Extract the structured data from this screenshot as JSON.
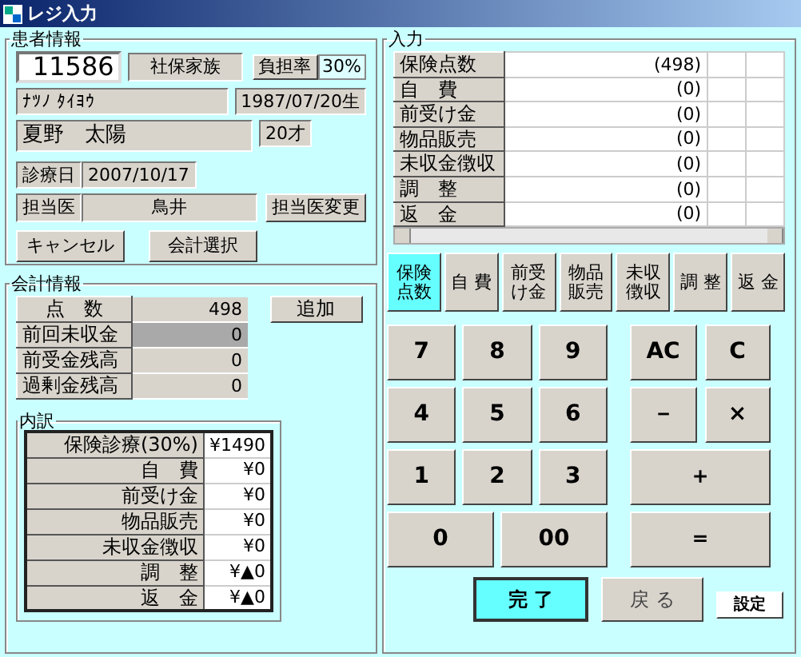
{
  "window": {
    "title": "レジ入力"
  },
  "patient": {
    "section_title": "患者情報",
    "id": "11586",
    "insurance_type": "社保家族",
    "burden_label": "負担率",
    "burden_rate": "30%",
    "kana_name": "ﾅﾂﾉ ﾀｲﾖｳ",
    "birth_date": "1987/07/20生",
    "name": "夏野　太陽",
    "age": "20才",
    "visit_label": "診療日",
    "visit_date": "2007/10/17",
    "doctor_label": "担当医",
    "doctor": "鳥井",
    "change_doctor_button": "担当医変更",
    "buttons": [
      "キャンセル",
      "会計選択"
    ]
  },
  "accounting": {
    "section_title": "会計情報",
    "add_button": "追加",
    "rows": [
      {
        "label": "点　数",
        "value": "498",
        "disabled": false
      },
      {
        "label": "前回未収金",
        "value": "0",
        "disabled": true
      },
      {
        "label": "前受金残高",
        "value": "0",
        "disabled": false
      },
      {
        "label": "過剰金残高",
        "value": "0",
        "disabled": false
      }
    ],
    "breakdown": {
      "title": "内訳",
      "rows": [
        {
          "label": "保険診療(30%)",
          "value": "¥1490"
        },
        {
          "label": "自　費",
          "value": "¥0"
        },
        {
          "label": "前受け金",
          "value": "¥0"
        },
        {
          "label": "物品販売",
          "value": "¥0"
        },
        {
          "label": "未収金徴収",
          "value": "¥0"
        },
        {
          "label": "調　整",
          "value": "¥▲0"
        },
        {
          "label": "返　金",
          "value": "¥▲0"
        }
      ]
    }
  },
  "input": {
    "section_title": "入力",
    "rows": [
      {
        "label": "保険点数",
        "value": "(498)"
      },
      {
        "label": "自　費",
        "value": "(0)"
      },
      {
        "label": "前受け金",
        "value": "(0)"
      },
      {
        "label": "物品販売",
        "value": "(0)"
      },
      {
        "label": "未収金徴収",
        "value": "(0)"
      },
      {
        "label": "調　整",
        "value": "(0)"
      },
      {
        "label": "返　金",
        "value": "(0)"
      }
    ],
    "category_buttons": [
      {
        "lines": [
          "保険",
          "点数"
        ],
        "selected": true
      },
      {
        "lines": [
          "自 費"
        ],
        "selected": false
      },
      {
        "lines": [
          "前受",
          "け金"
        ],
        "selected": false
      },
      {
        "lines": [
          "物品",
          "販売"
        ],
        "selected": false
      },
      {
        "lines": [
          "未収",
          "徴収"
        ],
        "selected": false
      },
      {
        "lines": [
          "調 整"
        ],
        "selected": false
      },
      {
        "lines": [
          "返 金"
        ],
        "selected": false
      }
    ],
    "number_keys": [
      {
        "label": "7",
        "kind": "single"
      },
      {
        "label": "8",
        "kind": "single"
      },
      {
        "label": "9",
        "kind": "single"
      },
      {
        "label": "4",
        "kind": "single"
      },
      {
        "label": "5",
        "kind": "single"
      },
      {
        "label": "6",
        "kind": "single"
      },
      {
        "label": "1",
        "kind": "single"
      },
      {
        "label": "2",
        "kind": "single"
      },
      {
        "label": "3",
        "kind": "single"
      },
      {
        "label": "0",
        "kind": "half"
      },
      {
        "label": "00",
        "kind": "half"
      }
    ],
    "operator_keys": [
      {
        "label": "AC",
        "kind": "single"
      },
      {
        "label": "C",
        "kind": "single"
      },
      {
        "label": "－",
        "kind": "single"
      },
      {
        "label": "×",
        "kind": "single"
      },
      {
        "label": "＋",
        "kind": "full"
      },
      {
        "label": "＝",
        "kind": "full"
      }
    ],
    "done_button": "完 了",
    "back_button": "戻 る",
    "settings_button": "設定"
  }
}
